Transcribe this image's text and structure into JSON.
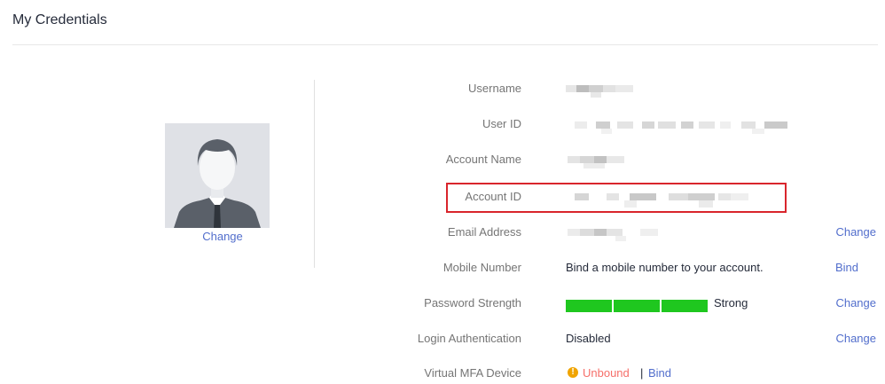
{
  "page": {
    "title": "My Credentials"
  },
  "avatar": {
    "change_label": "Change",
    "icon": "default-user-avatar"
  },
  "fields": {
    "username": {
      "label": "Username",
      "value_redacted": true
    },
    "user_id": {
      "label": "User ID",
      "value_redacted": true
    },
    "account_name": {
      "label": "Account Name",
      "value_redacted": true
    },
    "account_id": {
      "label": "Account ID",
      "value_redacted": true
    },
    "email": {
      "label": "Email Address",
      "value_redacted": true,
      "action": "Change"
    },
    "mobile": {
      "label": "Mobile Number",
      "value": "Bind a mobile number to your account.",
      "action": "Bind"
    },
    "password": {
      "label": "Password Strength",
      "strength_text": "Strong",
      "strength_segments": 3,
      "action": "Change"
    },
    "login_auth": {
      "label": "Login Authentication",
      "value": "Disabled",
      "action": "Change"
    },
    "mfa": {
      "label": "Virtual MFA Device",
      "status": "Unbound",
      "separator": "|",
      "action": "Bind"
    }
  },
  "colors": {
    "link": "#526ecc",
    "highlight_border": "#d9252c",
    "strength_bar": "#1fc71f",
    "warning": "#f0a400",
    "unbound_text": "#f66f6a"
  }
}
